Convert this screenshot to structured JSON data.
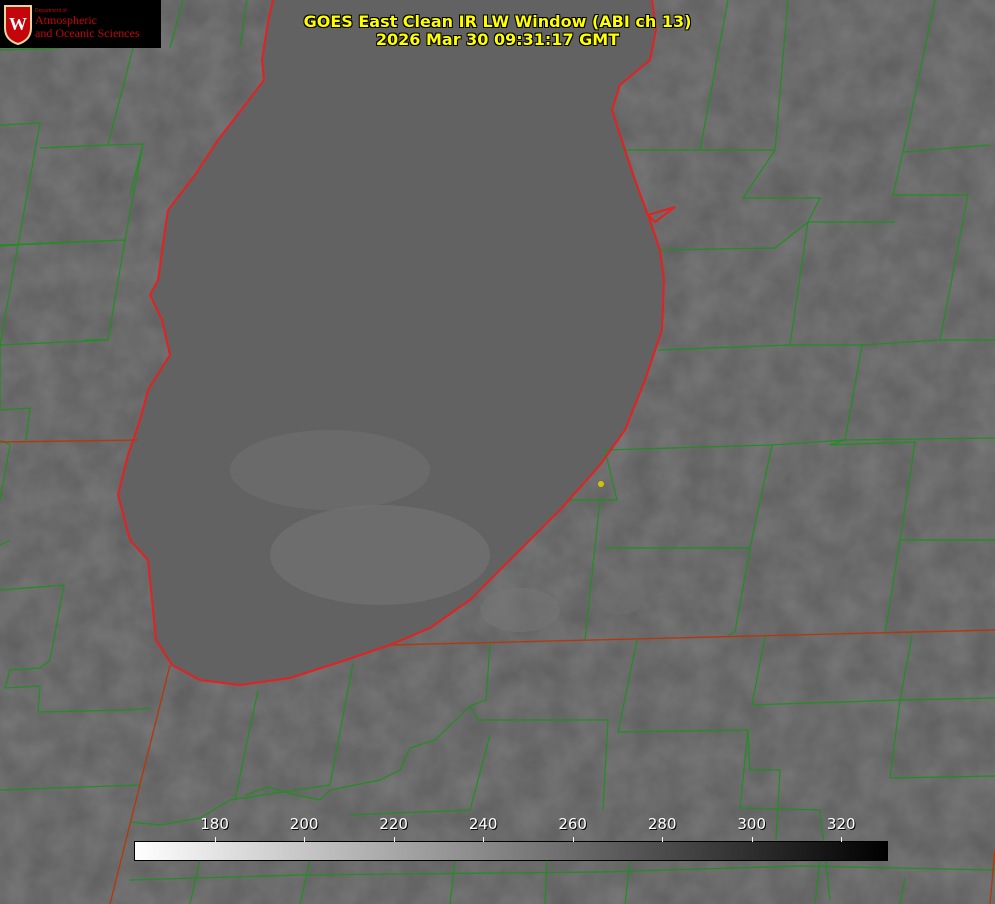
{
  "logo": {
    "department": "Department of",
    "line1": "Atmospheric",
    "line2": "and Oceanic Sciences",
    "emblem": "W"
  },
  "title": {
    "line1": "GOES East Clean IR LW Window (ABI ch 13)",
    "line2": "2026 Mar 30 09:31:17 GMT"
  },
  "colorbar": {
    "ticks": [
      "180",
      "200",
      "220",
      "240",
      "260",
      "280",
      "300",
      "320"
    ],
    "range": [
      162,
      330
    ],
    "gradient": "white-to-black"
  },
  "colors": {
    "county_lines": "#1f8f1f",
    "state_lines": "#b03a10",
    "coastline": "#e52020",
    "title_text": "#ffff00",
    "marker": "#d4c400"
  },
  "marker": {
    "icon": "location-dot-icon"
  }
}
